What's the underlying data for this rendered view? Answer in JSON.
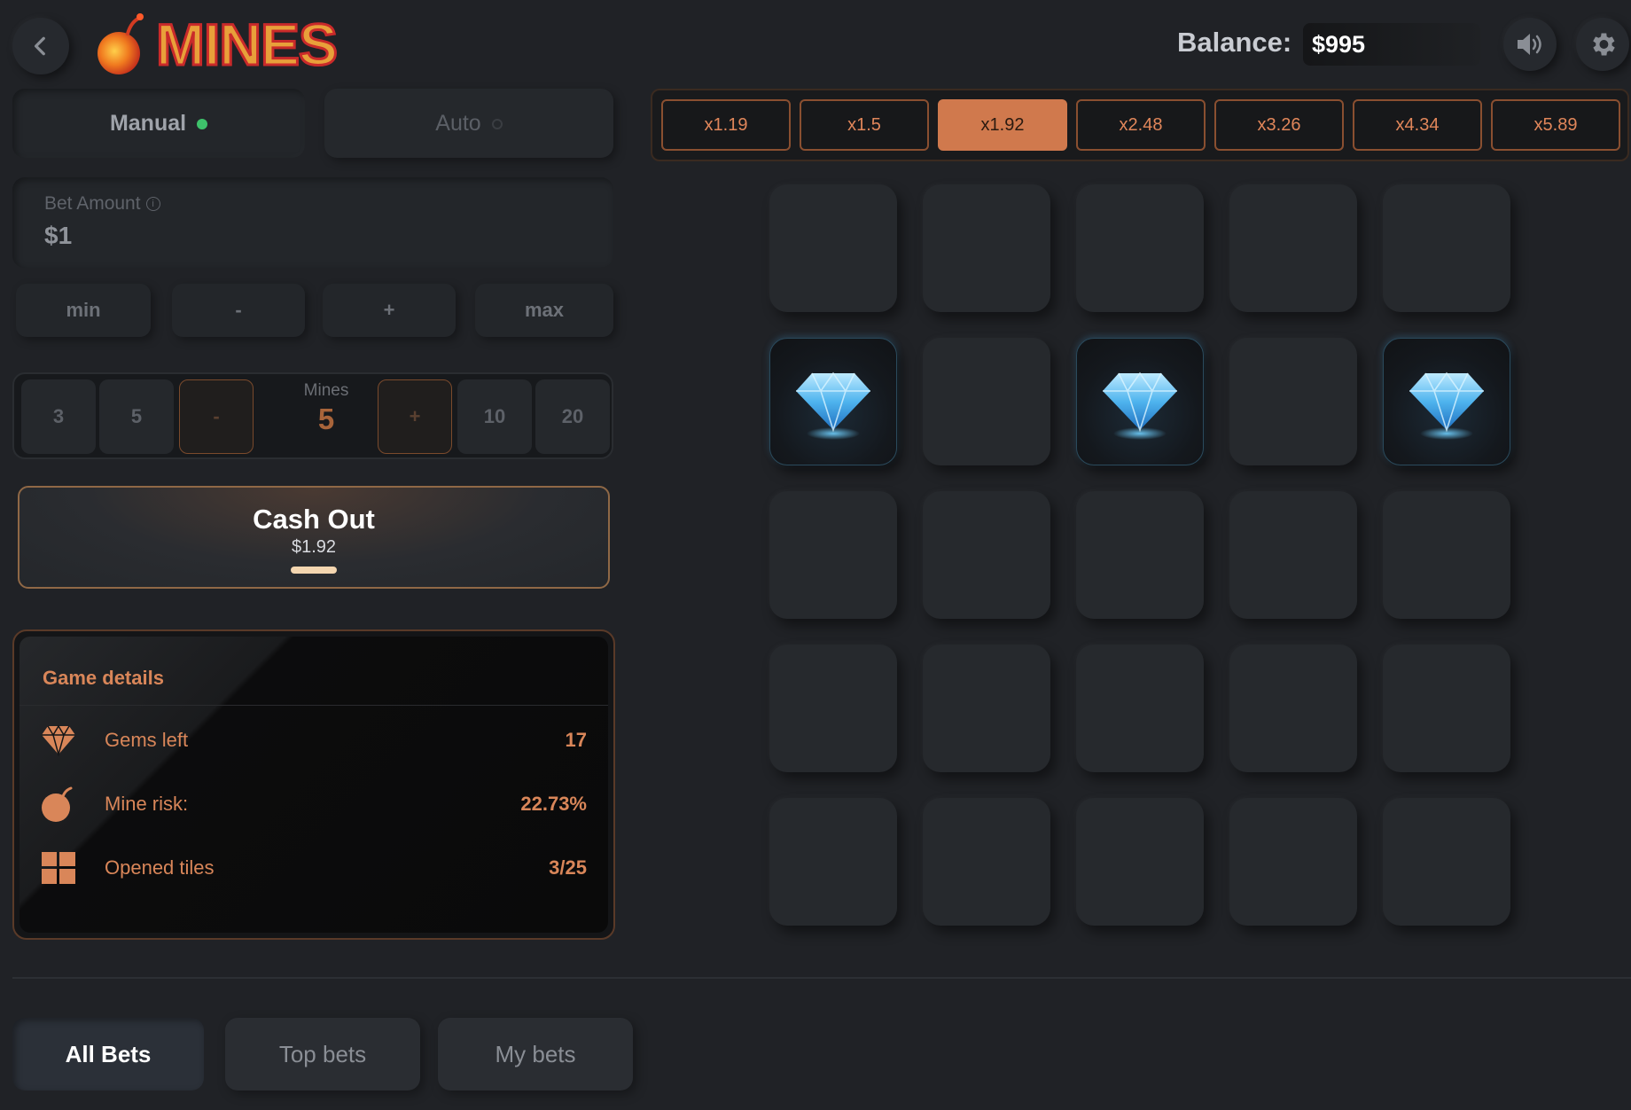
{
  "header": {
    "title": "MINES",
    "balance_label": "Balance:",
    "balance_value": "$995",
    "icons": {
      "back": "chevron-left-icon",
      "logo": "bomb-icon",
      "sound": "speaker-icon",
      "settings": "gear-icon"
    }
  },
  "mode_tabs": [
    {
      "label": "Manual",
      "active": true
    },
    {
      "label": "Auto",
      "active": false
    }
  ],
  "bet": {
    "label": "Bet Amount",
    "value": "$1",
    "buttons": [
      "min",
      "-",
      "+",
      "max"
    ]
  },
  "mines": {
    "label": "Mines",
    "value": "5",
    "presets_left": [
      "3",
      "5"
    ],
    "presets_right": [
      "10",
      "20"
    ],
    "decrement": "-",
    "increment": "+"
  },
  "cashout": {
    "label": "Cash Out",
    "amount": "$1.92"
  },
  "details": {
    "title": "Game details",
    "rows": [
      {
        "label": "Gems left",
        "value": "17",
        "icon": "diamond-icon"
      },
      {
        "label": "Mine risk:",
        "value": "22.73%",
        "icon": "bomb-icon"
      },
      {
        "label": "Opened tiles",
        "value": "3/25",
        "icon": "grid-icon"
      }
    ]
  },
  "multipliers": {
    "values": [
      "x1.19",
      "x1.5",
      "x1.92",
      "x2.48",
      "x3.26",
      "x4.34",
      "x5.89"
    ],
    "active_index": 2
  },
  "grid": {
    "rows": 5,
    "cols": 5,
    "revealed_gems": [
      [
        1,
        0
      ],
      [
        1,
        2
      ],
      [
        1,
        4
      ]
    ]
  },
  "bets_tabs": [
    {
      "label": "All Bets",
      "active": true
    },
    {
      "label": "Top bets",
      "active": false
    },
    {
      "label": "My bets",
      "active": false
    }
  ],
  "colors": {
    "background": "#202226",
    "accent": "#d0794d",
    "status_on": "#3ec26b"
  }
}
